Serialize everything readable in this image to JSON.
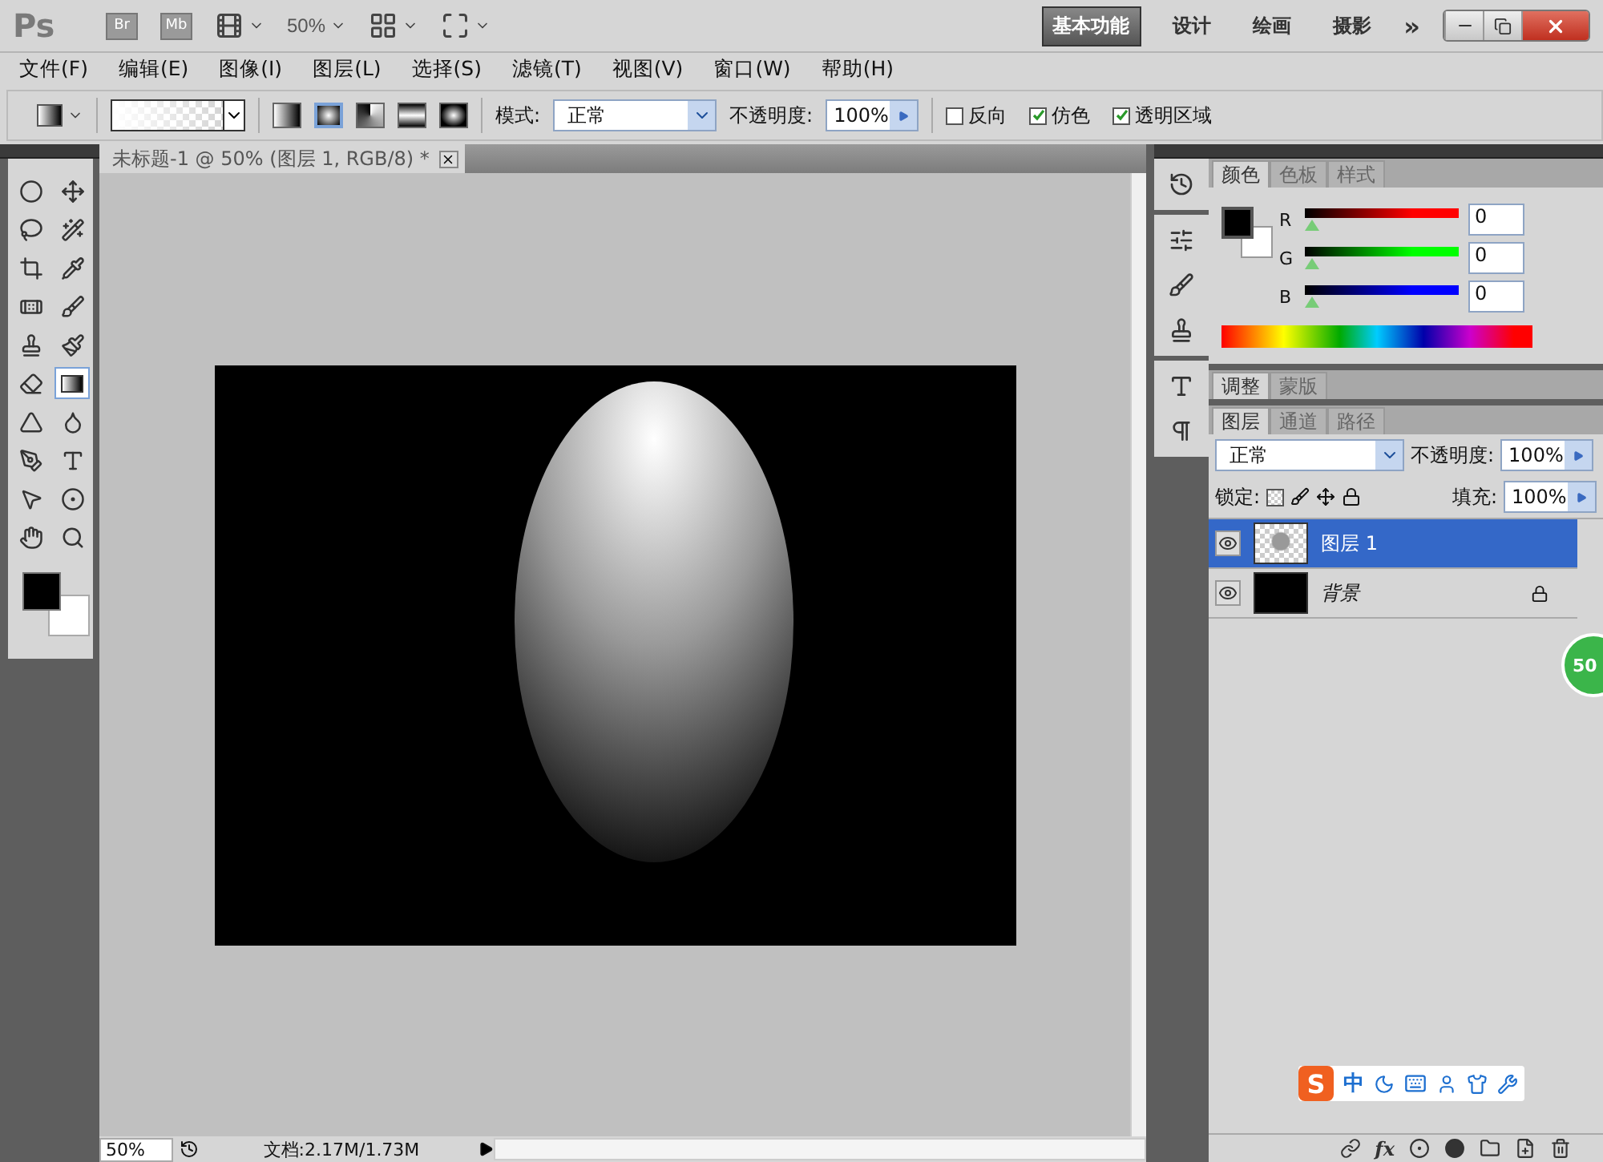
{
  "app_bar": {
    "logo": "Ps",
    "launchers": [
      "Br",
      "Mb"
    ],
    "zoom": "50%",
    "workspaces": [
      {
        "label": "基本功能",
        "selected": true
      },
      {
        "label": "设计",
        "selected": false
      },
      {
        "label": "绘画",
        "selected": false
      },
      {
        "label": "摄影",
        "selected": false
      }
    ],
    "more": "»"
  },
  "menu": [
    "文件(F)",
    "编辑(E)",
    "图像(I)",
    "图层(L)",
    "选择(S)",
    "滤镜(T)",
    "视图(V)",
    "窗口(W)",
    "帮助(H)"
  ],
  "options_bar": {
    "gradient_types": [
      {
        "kind": "linear",
        "selected": false
      },
      {
        "kind": "radial",
        "selected": true
      },
      {
        "kind": "angle",
        "selected": false
      },
      {
        "kind": "reflected",
        "selected": false
      },
      {
        "kind": "diamond",
        "selected": false
      }
    ],
    "mode_label": "模式:",
    "mode": "正常",
    "opacity_label": "不透明度:",
    "opacity": "100%",
    "checkboxes": [
      {
        "label": "反向",
        "checked": false
      },
      {
        "label": "仿色",
        "checked": true
      },
      {
        "label": "透明区域",
        "checked": true
      }
    ]
  },
  "document_tab": {
    "title": "未标题-1 @ 50% (图层 1, RGB/8) *"
  },
  "tools": [
    {
      "kind": "marquee",
      "selected": false
    },
    {
      "kind": "move",
      "selected": false
    },
    {
      "kind": "lasso",
      "selected": false
    },
    {
      "kind": "quick-select",
      "selected": false
    },
    {
      "kind": "crop",
      "selected": false
    },
    {
      "kind": "eyedropper",
      "selected": false
    },
    {
      "kind": "heal",
      "selected": false
    },
    {
      "kind": "brush",
      "selected": false
    },
    {
      "kind": "stamp",
      "selected": false
    },
    {
      "kind": "history-brush",
      "selected": false
    },
    {
      "kind": "eraser",
      "selected": false
    },
    {
      "kind": "gradient",
      "selected": true
    },
    {
      "kind": "blur",
      "selected": false
    },
    {
      "kind": "dodge",
      "selected": false
    },
    {
      "kind": "pen",
      "selected": false
    },
    {
      "kind": "type",
      "selected": false
    },
    {
      "kind": "path-select",
      "selected": false
    },
    {
      "kind": "shape",
      "selected": false
    },
    {
      "kind": "hand",
      "selected": false
    },
    {
      "kind": "zoom",
      "selected": false
    }
  ],
  "color_panel": {
    "tabs": [
      {
        "label": "颜色",
        "selected": true
      },
      {
        "label": "色板",
        "selected": false
      },
      {
        "label": "样式",
        "selected": false
      }
    ],
    "channels": [
      {
        "name": "R",
        "value": "0",
        "level": 0,
        "color": "#ff0000"
      },
      {
        "name": "G",
        "value": "0",
        "level": 0,
        "color": "#00ff00"
      },
      {
        "name": "B",
        "value": "0",
        "level": 0,
        "color": "#0000ff"
      }
    ]
  },
  "adjust_panel": {
    "tabs": [
      {
        "label": "调整",
        "selected": true
      },
      {
        "label": "蒙版",
        "selected": false
      }
    ]
  },
  "layers_panel": {
    "tabs": [
      {
        "label": "图层",
        "selected": true
      },
      {
        "label": "通道",
        "selected": false
      },
      {
        "label": "路径",
        "selected": false
      }
    ],
    "blend_mode": "正常",
    "opacity_label": "不透明度:",
    "opacity": "100%",
    "lock_label": "锁定:",
    "fill_label": "填充:",
    "fill": "100%",
    "layers": [
      {
        "kind": "layer",
        "name": "图层 1",
        "selected": true,
        "visible": true,
        "locked": false
      },
      {
        "kind": "background",
        "name": "背景",
        "selected": false,
        "visible": true,
        "locked": true
      }
    ],
    "effects_label": "fx"
  },
  "status_bar": {
    "zoom": "50%",
    "document": "文档:2.17M/1.73M"
  },
  "ime_bar": {
    "logo": "S",
    "mode": "中"
  },
  "floating_badge": {
    "text": "50"
  }
}
